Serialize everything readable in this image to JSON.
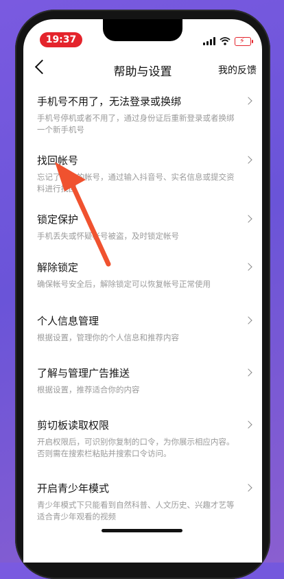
{
  "status": {
    "time": "19:37"
  },
  "header": {
    "title": "帮助与设置",
    "right_link": "我的反馈"
  },
  "items": [
    {
      "title": "手机号不用了，无法登录或换绑",
      "desc": "手机号停机或者不用了，通过身份证后重新登录或者换绑一个新手机号"
    },
    {
      "title": "找回帐号",
      "desc": "忘记了登录的帐号，通过输入抖音号、实名信息或提交资料进行找回"
    },
    {
      "title": "锁定保护",
      "desc": "手机丢失或怀疑帐号被盗，及时锁定帐号"
    },
    {
      "title": "解除锁定",
      "desc": "确保帐号安全后，解除锁定可以恢复帐号正常使用"
    },
    {
      "title": "个人信息管理",
      "desc": "根据设置，管理你的个人信息和推荐内容"
    },
    {
      "title": "了解与管理广告推送",
      "desc": "根据设置，推荐适合你的内容"
    },
    {
      "title": "剪切板读取权限",
      "desc": "开启权限后，可识别你复制的口令，为你展示相应内容。否则需在搜索栏粘贴并搜索口令访问。"
    },
    {
      "title": "开启青少年模式",
      "desc": "青少年模式下只能看到自然科普、人文历史、兴趣才艺等适合青少年观看的视频"
    }
  ],
  "colors": {
    "accent": "#e4242c",
    "arrow": "#f0522f"
  }
}
